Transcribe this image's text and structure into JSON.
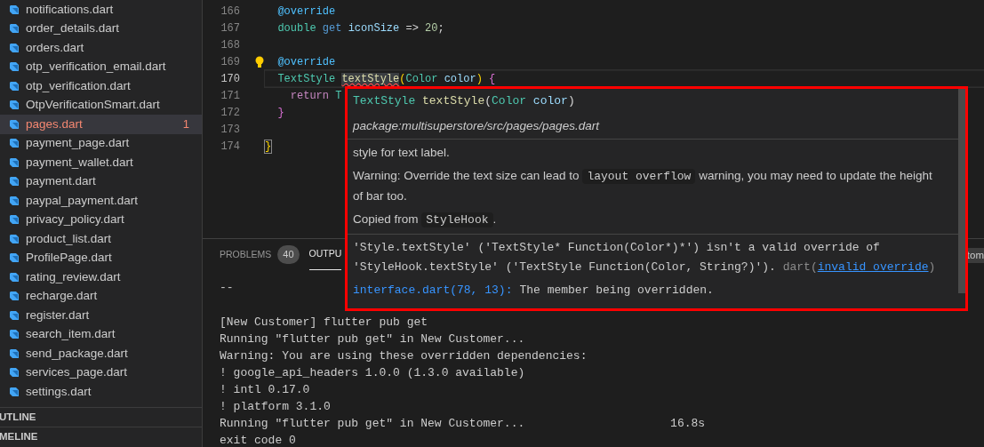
{
  "sidebar": {
    "files": [
      {
        "name": "notifications.dart",
        "selected": false
      },
      {
        "name": "order_details.dart",
        "selected": false
      },
      {
        "name": "orders.dart",
        "selected": false
      },
      {
        "name": "otp_verification_email.dart",
        "selected": false
      },
      {
        "name": "otp_verification.dart",
        "selected": false
      },
      {
        "name": "OtpVerificationSmart.dart",
        "selected": false
      },
      {
        "name": "pages.dart",
        "selected": true,
        "problems": "1"
      },
      {
        "name": "payment_page.dart",
        "selected": false
      },
      {
        "name": "payment_wallet.dart",
        "selected": false
      },
      {
        "name": "payment.dart",
        "selected": false
      },
      {
        "name": "paypal_payment.dart",
        "selected": false
      },
      {
        "name": "privacy_policy.dart",
        "selected": false
      },
      {
        "name": "product_list.dart",
        "selected": false
      },
      {
        "name": "ProfilePage.dart",
        "selected": false
      },
      {
        "name": "rating_review.dart",
        "selected": false
      },
      {
        "name": "recharge.dart",
        "selected": false
      },
      {
        "name": "register.dart",
        "selected": false
      },
      {
        "name": "search_item.dart",
        "selected": false
      },
      {
        "name": "send_package.dart",
        "selected": false
      },
      {
        "name": "services_page.dart",
        "selected": false
      },
      {
        "name": "settings.dart",
        "selected": false
      }
    ],
    "sections": [
      "UTLINE",
      "MELINE"
    ]
  },
  "editor": {
    "lines": [
      {
        "number": "166",
        "current": false,
        "tokens": [
          {
            "text": "  @override",
            "kind": "decorator"
          }
        ]
      },
      {
        "number": "167",
        "current": false,
        "tokens": [
          {
            "text": "  double ",
            "kind": "type"
          },
          {
            "text": "get ",
            "kind": "keyword"
          },
          {
            "text": "iconSize ",
            "kind": "param"
          },
          {
            "text": "=> ",
            "kind": "plain"
          },
          {
            "text": "20",
            "kind": "number"
          },
          {
            "text": ";",
            "kind": "plain"
          }
        ]
      },
      {
        "number": "168",
        "current": false
      },
      {
        "number": "169",
        "current": false,
        "lightbulb": true,
        "tokens": [
          {
            "text": "  @override",
            "kind": "decorator"
          }
        ]
      },
      {
        "number": "170",
        "current": true,
        "tokens": [
          {
            "text": "  TextStyle ",
            "kind": "type"
          },
          {
            "text": "textStyle",
            "kind": "func",
            "error": true
          },
          {
            "text": "(",
            "kind": "bracket"
          },
          {
            "text": "Color ",
            "kind": "type"
          },
          {
            "text": "color",
            "kind": "param"
          },
          {
            "text": ") ",
            "kind": "bracket"
          },
          {
            "text": "{",
            "kind": "bracket2"
          }
        ]
      },
      {
        "number": "171",
        "current": false,
        "tokens": [
          {
            "text": "    return ",
            "kind": "control"
          },
          {
            "text": "T",
            "kind": "type"
          }
        ]
      },
      {
        "number": "172",
        "current": false,
        "tokens": [
          {
            "text": "  }",
            "kind": "bracket2"
          }
        ]
      },
      {
        "number": "173",
        "current": false
      },
      {
        "number": "174",
        "current": false,
        "tokens": [
          {
            "text": "}",
            "kind": "bracket",
            "matched": true
          }
        ]
      }
    ]
  },
  "hover": {
    "signature": [
      {
        "text": "TextStyle ",
        "kind": "type"
      },
      {
        "text": "textStyle",
        "kind": "func"
      },
      {
        "text": "(",
        "kind": "plain"
      },
      {
        "text": "Color ",
        "kind": "type"
      },
      {
        "text": "color",
        "kind": "param"
      },
      {
        "text": ")",
        "kind": "plain"
      }
    ],
    "package": "package:multisuperstore/src/pages/pages.dart",
    "doc": [
      [
        {
          "text": "style for text label.",
          "code": false
        }
      ],
      [
        {
          "text": "Warning: Override the text size can lead to ",
          "code": false
        },
        {
          "text": "layout overflow",
          "code": true
        },
        {
          "text": " warning, you may need to update the height of bar too.",
          "code": false
        }
      ],
      [
        {
          "text": "Copied from ",
          "code": false
        },
        {
          "text": "StyleHook",
          "code": true
        },
        {
          "text": ".",
          "code": false
        }
      ]
    ],
    "error": {
      "message": "'Style.textStyle' ('TextStyle* Function(Color*)*') isn't a valid override of 'StyleHook.textStyle' ('TextStyle Function(Color, String?)').",
      "source": "dart(",
      "code": "invalid_override",
      "close": ")"
    },
    "related": {
      "location": "interface.dart(78, 13):",
      "message": "The member being overridden."
    }
  },
  "panel": {
    "tabs": [
      {
        "label": "PROBLEMS",
        "badge": "40",
        "selected": false
      },
      {
        "label": "OUTPU",
        "selected": true
      }
    ],
    "right_text": "tom",
    "output": [
      "--",
      {
        "text": "[New Customer] flutter pub get",
        "blank_before": true
      },
      "Running \"flutter pub get\" in New Customer...",
      "Warning: You are using these overridden dependencies:",
      "! google_api_headers 1.0.0 (1.3.0 available)",
      "! intl 0.17.0",
      "! platform 3.1.0",
      "Running \"flutter pub get\" in New Customer...                     16.8s",
      "exit code 0"
    ]
  }
}
